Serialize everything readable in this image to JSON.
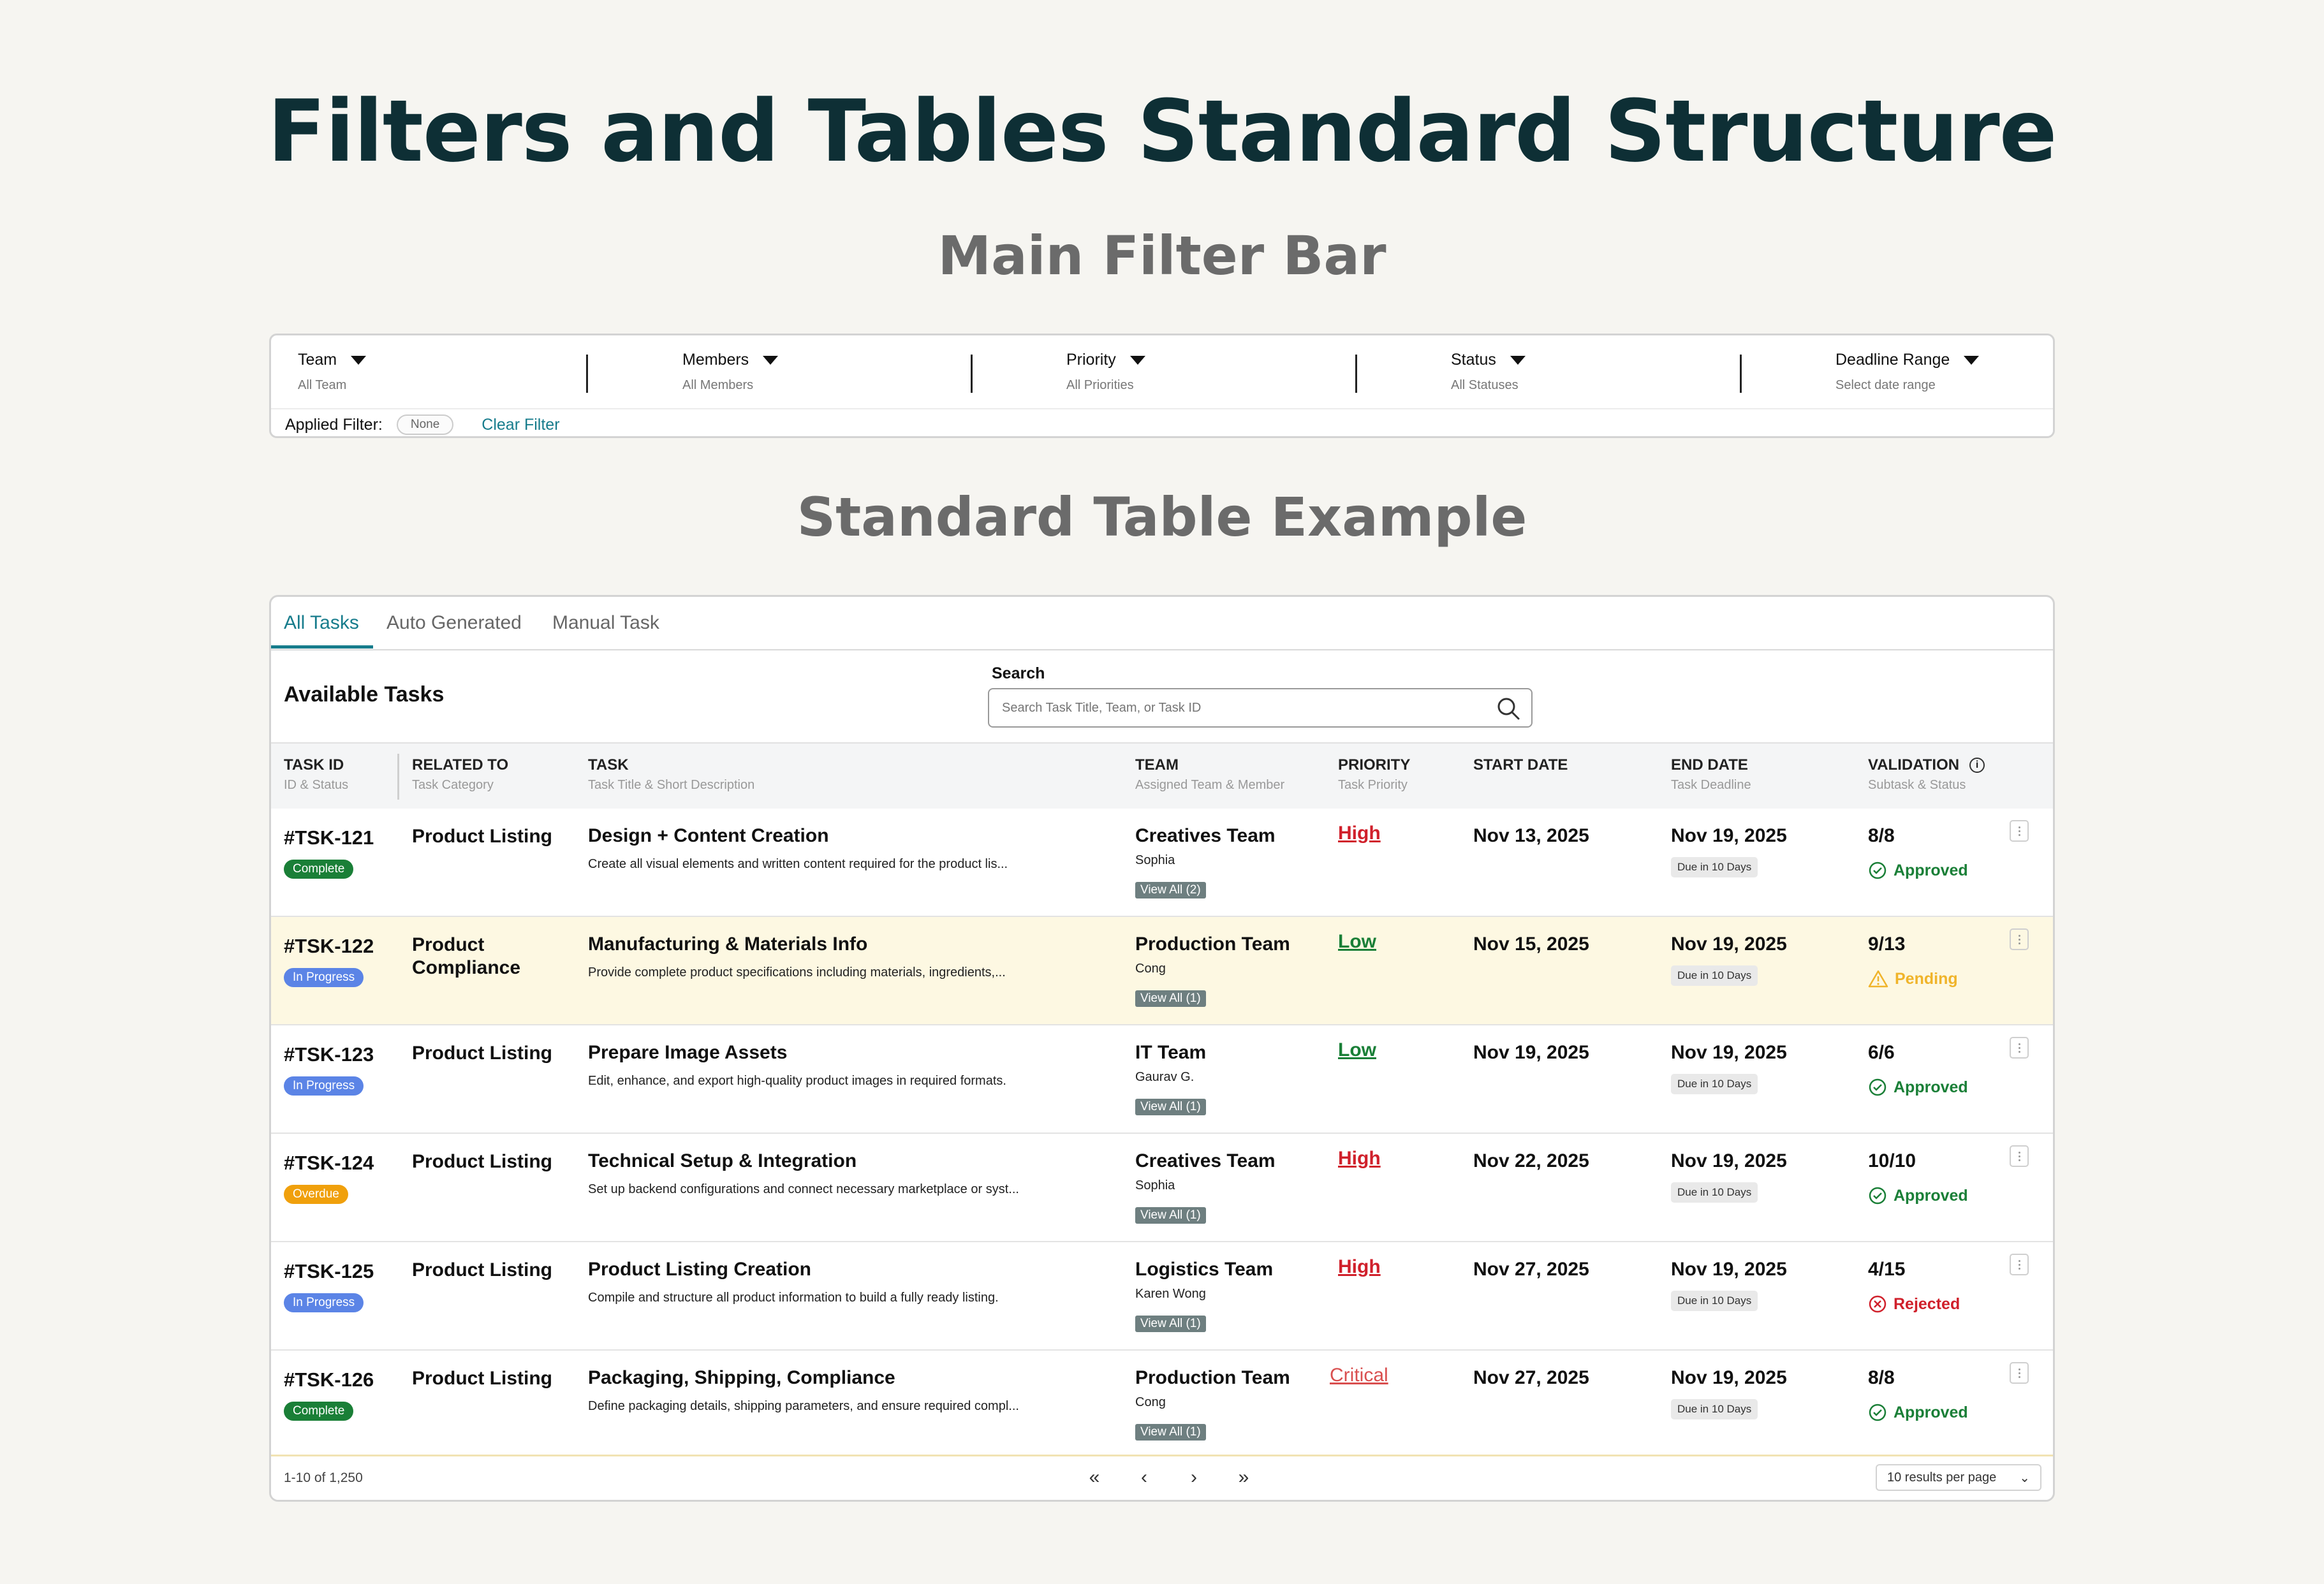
{
  "page_title": "Filters and Tables Standard Structure",
  "section_filter_title": "Main Filter Bar",
  "section_table_title": "Standard Table Example",
  "filters": [
    {
      "label": "Team",
      "value": "All Team"
    },
    {
      "label": "Members",
      "value": "All Members"
    },
    {
      "label": "Priority",
      "value": "All Priorities"
    },
    {
      "label": "Status",
      "value": "All Statuses"
    },
    {
      "label": "Deadline Range",
      "value": "Select date range"
    }
  ],
  "applied_filter": {
    "label": "Applied Filter:",
    "value": "None",
    "clear_label": "Clear Filter"
  },
  "tabs": [
    "All Tasks",
    "Auto Generated",
    "Manual Task"
  ],
  "active_tab": "All Tasks",
  "table_title": "Available Tasks",
  "search": {
    "label": "Search",
    "placeholder": "Search Task Title, Team, or Task ID"
  },
  "columns": [
    {
      "title": "TASK ID",
      "sub": "ID & Status"
    },
    {
      "title": "RELATED TO",
      "sub": "Task Category"
    },
    {
      "title": "TASK",
      "sub": "Task Title & Short Description"
    },
    {
      "title": "TEAM",
      "sub": "Assigned Team & Member"
    },
    {
      "title": "PRIORITY",
      "sub": "Task Priority"
    },
    {
      "title": "START DATE",
      "sub": ""
    },
    {
      "title": "END DATE",
      "sub": "Task Deadline"
    },
    {
      "title": "VALIDATION",
      "sub": "Subtask & Status"
    }
  ],
  "rows": [
    {
      "id": "#TSK-121",
      "status": "Complete",
      "related": "Product Listing",
      "task": "Design + Content Creation",
      "desc": "Create all visual elements and written content required for the product lis...",
      "team": "Creatives Team",
      "member": "Sophia",
      "view_all": "View All (2)",
      "priority": "High",
      "start": "Nov 13, 2025",
      "end": "Nov 19, 2025",
      "due": "Due in 10 Days",
      "ratio": "8/8",
      "validation": "Approved"
    },
    {
      "id": "#TSK-122",
      "status": "In Progress",
      "related": "Product Compliance",
      "task": "Manufacturing & Materials Info",
      "desc": "Provide complete product specifications including materials, ingredients,...",
      "team": "Production Team",
      "member": "Cong",
      "view_all": "View All (1)",
      "priority": "Low",
      "start": "Nov 15, 2025",
      "end": "Nov 19, 2025",
      "due": "Due in 10 Days",
      "ratio": "9/13",
      "validation": "Pending"
    },
    {
      "id": "#TSK-123",
      "status": "In Progress",
      "related": "Product Listing",
      "task": "Prepare Image Assets",
      "desc": "Edit, enhance, and export high-quality product images in required formats.",
      "team": "IT Team",
      "member": "Gaurav G.",
      "view_all": "View All (1)",
      "priority": "Low",
      "start": "Nov 19, 2025",
      "end": "Nov 19, 2025",
      "due": "Due in 10 Days",
      "ratio": "6/6",
      "validation": "Approved"
    },
    {
      "id": "#TSK-124",
      "status": "Overdue",
      "related": "Product Listing",
      "task": "Technical Setup & Integration",
      "desc": "Set up backend configurations and connect necessary marketplace or syst...",
      "team": "Creatives Team",
      "member": "Sophia",
      "view_all": "View All (1)",
      "priority": "High",
      "start": "Nov 22, 2025",
      "end": "Nov 19, 2025",
      "due": "Due in 10 Days",
      "ratio": "10/10",
      "validation": "Approved"
    },
    {
      "id": "#TSK-125",
      "status": "In Progress",
      "related": "Product Listing",
      "task": "Product Listing Creation",
      "desc": "Compile and structure all product information to build a fully ready listing.",
      "team": "Logistics Team",
      "member": "Karen Wong",
      "view_all": "View All (1)",
      "priority": "High",
      "start": "Nov 27, 2025",
      "end": "Nov 19, 2025",
      "due": "Due in 10 Days",
      "ratio": "4/15",
      "validation": "Rejected"
    },
    {
      "id": "#TSK-126",
      "status": "Complete",
      "related": "Product Listing",
      "task": "Packaging, Shipping, Compliance",
      "desc": "Define packaging details, shipping parameters, and ensure required compl...",
      "team": "Production Team",
      "member": "Cong",
      "view_all": "View All (1)",
      "priority": "Critical",
      "start": "Nov 27, 2025",
      "end": "Nov 19, 2025",
      "due": "Due in 10 Days",
      "ratio": "8/8",
      "validation": "Approved"
    }
  ],
  "pagination": {
    "range": "1-10 of 1,250",
    "per_page": "10 results per page"
  },
  "colors": {
    "accent": "#177c8c",
    "complete": "#1a7f37",
    "in_progress": "#5b84e6",
    "overdue": "#f0a00c",
    "high": "#d0202b",
    "pending": "#f0b42a",
    "highlight_row": "#fdf8e2"
  }
}
